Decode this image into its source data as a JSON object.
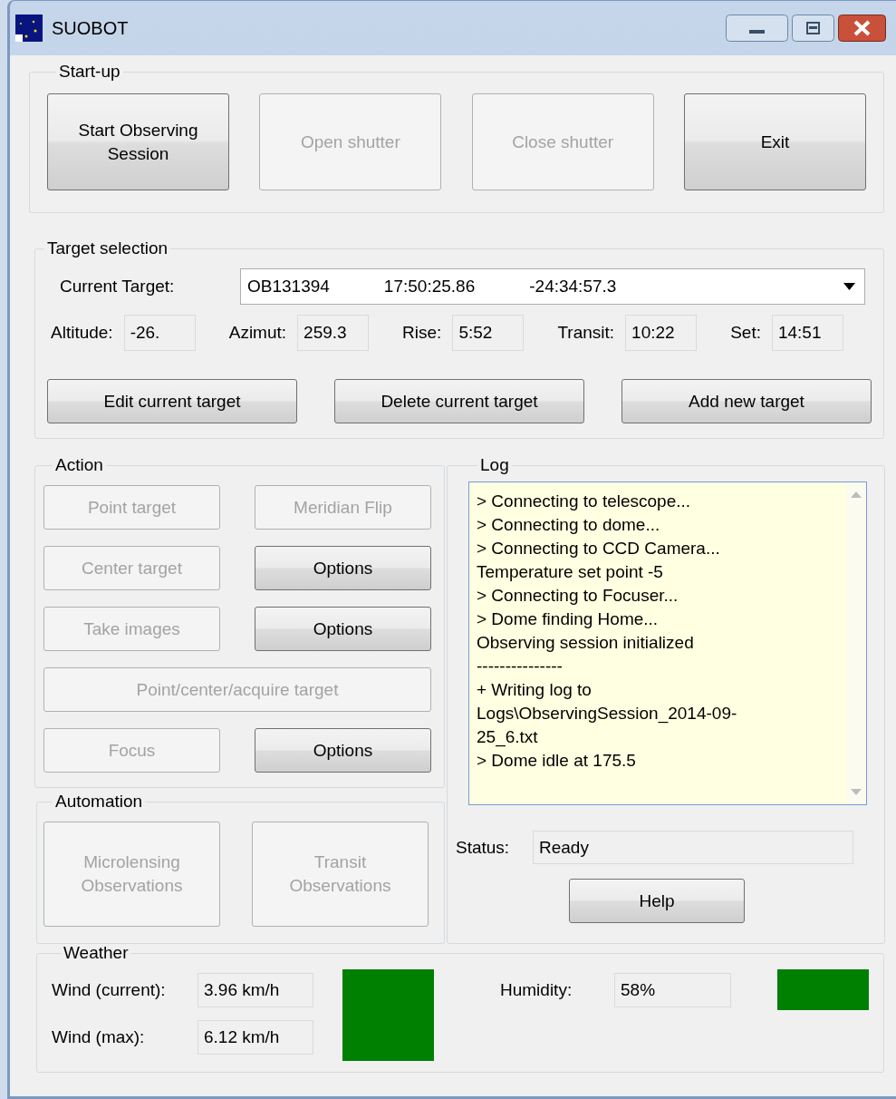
{
  "window": {
    "title": "SUOBOT"
  },
  "startup": {
    "legend": "Start-up",
    "buttons": [
      {
        "label": "Start Observing Session",
        "disabled": false
      },
      {
        "label": "Open shutter",
        "disabled": true
      },
      {
        "label": "Close shutter",
        "disabled": true
      },
      {
        "label": "Exit",
        "disabled": false
      }
    ]
  },
  "target": {
    "legend": "Target selection",
    "current_label": "Current Target:",
    "current_value": [
      "OB131394",
      "17:50:25.86",
      "-24:34:57.3"
    ],
    "readouts": [
      {
        "label": "Altitude:",
        "value": "-26."
      },
      {
        "label": "Azimut:",
        "value": "259.3"
      },
      {
        "label": "Rise:",
        "value": "5:52"
      },
      {
        "label": "Transit:",
        "value": "10:22"
      },
      {
        "label": "Set:",
        "value": "14:51"
      }
    ],
    "buttons": [
      {
        "label": "Edit current target",
        "disabled": false
      },
      {
        "label": "Delete current target",
        "disabled": false
      },
      {
        "label": "Add new target",
        "disabled": false
      }
    ]
  },
  "action": {
    "legend": "Action",
    "rows": [
      [
        {
          "label": "Point target",
          "disabled": true
        },
        {
          "label": "Meridian Flip",
          "disabled": true
        }
      ],
      [
        {
          "label": "Center target",
          "disabled": true
        },
        {
          "label": "Options",
          "disabled": false
        }
      ],
      [
        {
          "label": "Take images",
          "disabled": true
        },
        {
          "label": "Options",
          "disabled": false
        }
      ],
      [
        {
          "label": "Point/center/acquire target",
          "disabled": true
        }
      ],
      [
        {
          "label": "Focus",
          "disabled": true
        },
        {
          "label": "Options",
          "disabled": false
        }
      ]
    ]
  },
  "automation": {
    "legend": "Automation",
    "buttons": [
      {
        "label": "Microlensing Observations",
        "disabled": true
      },
      {
        "label": "Transit Observations",
        "disabled": true
      }
    ]
  },
  "log": {
    "legend": "Log",
    "lines": [
      "> Connecting to telescope...",
      "> Connecting to dome...",
      "> Connecting to CCD Camera...",
      "Temperature set point -5",
      "> Connecting to Focuser...",
      "> Dome finding Home...",
      "Observing session initialized",
      "---------------",
      "+ Writing log to",
      "Logs\\ObservingSession_2014-09-",
      "25_6.txt",
      "> Dome idle at 175.5"
    ]
  },
  "status": {
    "label": "Status:",
    "value": "Ready"
  },
  "help_button": {
    "label": "Help",
    "disabled": false
  },
  "weather": {
    "legend": "Weather",
    "wind_current": {
      "label": "Wind (current):",
      "value": "3.96 km/h"
    },
    "wind_max": {
      "label": "Wind (max):",
      "value": "6.12 km/h"
    },
    "wind_indicator": {
      "color": "#008000"
    },
    "humidity": {
      "label": "Humidity:",
      "value": "58%"
    },
    "humidity_indicator": {
      "color": "#008000"
    }
  }
}
